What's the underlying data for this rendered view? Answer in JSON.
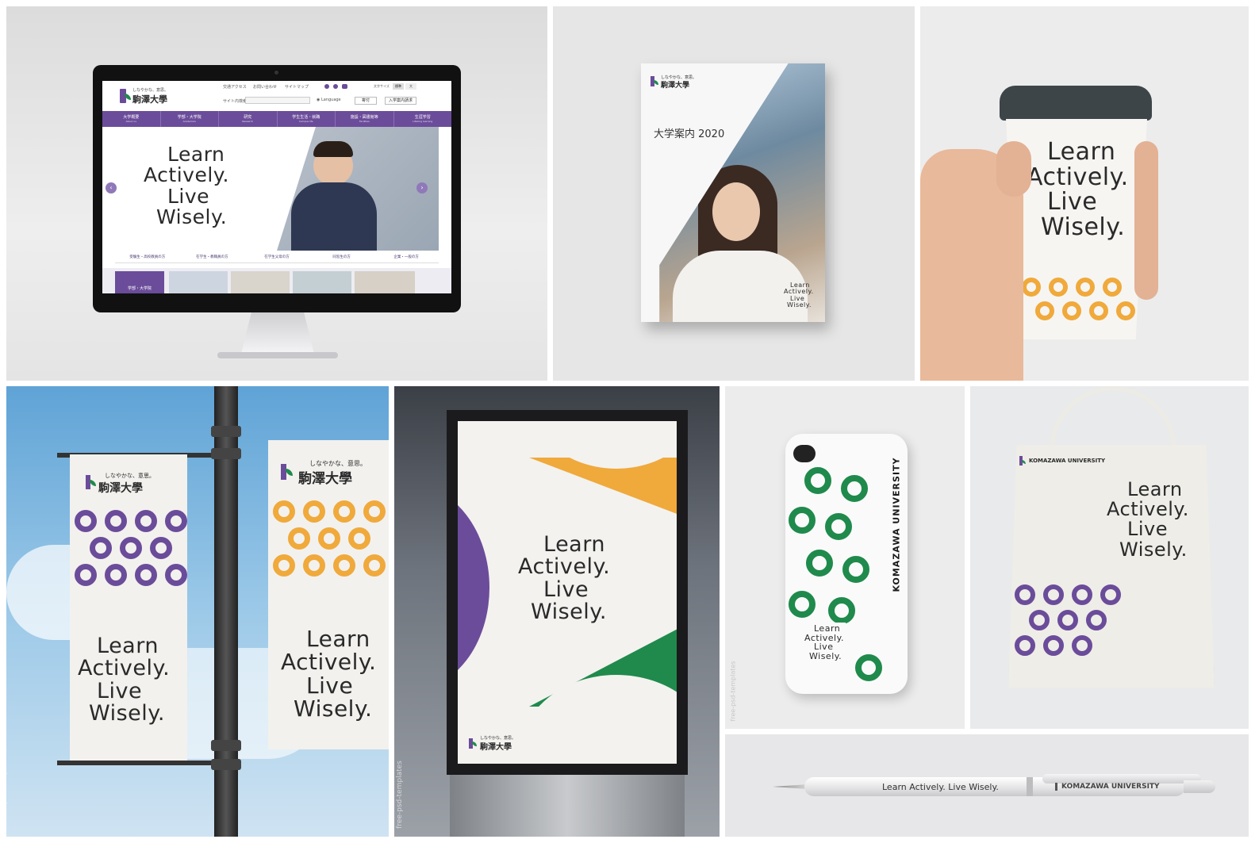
{
  "palette": {
    "purple": "#6b4c9a",
    "orange": "#f0a93b",
    "green": "#1f8a4c",
    "dark": "#2a2a2a"
  },
  "slogan": {
    "l1": "Learn",
    "l2": "Actively.",
    "l3": "Live",
    "l4": "Wisely."
  },
  "slogan_inline": "Learn Actively. Live Wisely.",
  "tagline_jp": "しなやかな、意思。",
  "logo_jp": "駒澤大學",
  "university_en": "KOMAZAWA UNIVERSITY",
  "website": {
    "top_links": [
      "交通アクセス",
      "お問い合わせ",
      "サイトマップ"
    ],
    "font_size_label": "文字サイズ",
    "size_options": [
      "標準",
      "大"
    ],
    "search_label": "サイト内検索",
    "language": "Language",
    "btn_donation": "寄付",
    "btn_admission": "入学案内請求",
    "nav": [
      {
        "jp": "大学概要",
        "en": "About us"
      },
      {
        "jp": "学部・大学院",
        "en": "Academics"
      },
      {
        "jp": "研究",
        "en": "Research"
      },
      {
        "jp": "学生生活・就職",
        "en": "Campus life"
      },
      {
        "jp": "施設・図書館等",
        "en": "Facilities"
      },
      {
        "jp": "生涯学習",
        "en": "Lifelong learning"
      }
    ],
    "quick_links": [
      "受験生・高校教員の方",
      "在学生・教職員の方",
      "在学生父母の方",
      "同窓生の方",
      "企業・一般の方"
    ],
    "section_label": "学部・大学院"
  },
  "brochure": {
    "title": "大学案内 2020"
  },
  "watermark": "free-psd-templates"
}
